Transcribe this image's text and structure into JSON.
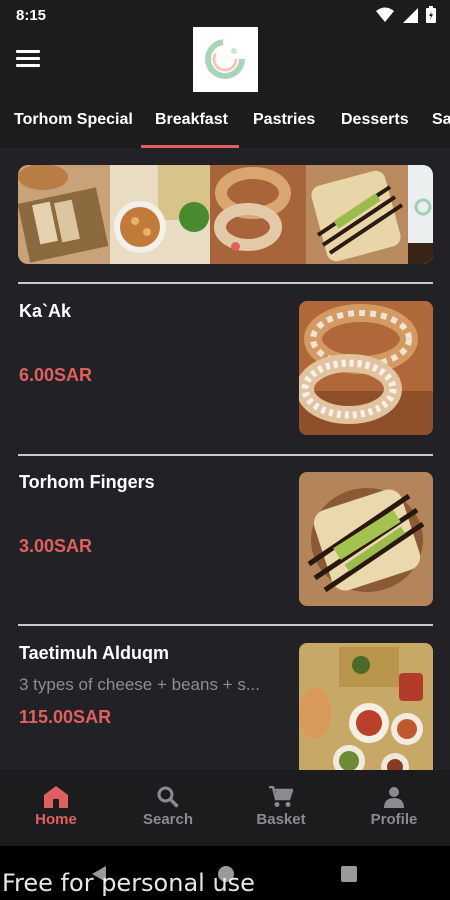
{
  "status": {
    "time": "8:15"
  },
  "colors": {
    "accent": "#e0605f",
    "background": "#222226",
    "bar": "#1c1c1f"
  },
  "tabs": [
    {
      "label": "Torhom Special"
    },
    {
      "label": "Breakfast",
      "selected": true
    },
    {
      "label": "Pastries"
    },
    {
      "label": "Desserts"
    },
    {
      "label": "Sa"
    }
  ],
  "menu_items": [
    {
      "name": "Ka`Ak",
      "description": "",
      "price": "6.00SAR",
      "image": "ring-bread-photo"
    },
    {
      "name": "Torhom Fingers",
      "description": "",
      "price": "3.00SAR",
      "image": "pastry-fingers-photo"
    },
    {
      "name": "Taetimuh Alduqm",
      "description": "3 types of cheese + beans + s...",
      "price": "115.00SAR",
      "image": "breakfast-platter-photo"
    }
  ],
  "bottom_nav": [
    {
      "label": "Home",
      "icon": "home-icon",
      "active": true
    },
    {
      "label": "Search",
      "icon": "search-icon"
    },
    {
      "label": "Basket",
      "icon": "cart-icon"
    },
    {
      "label": "Profile",
      "icon": "person-icon"
    }
  ],
  "watermark": "Free for personal use"
}
